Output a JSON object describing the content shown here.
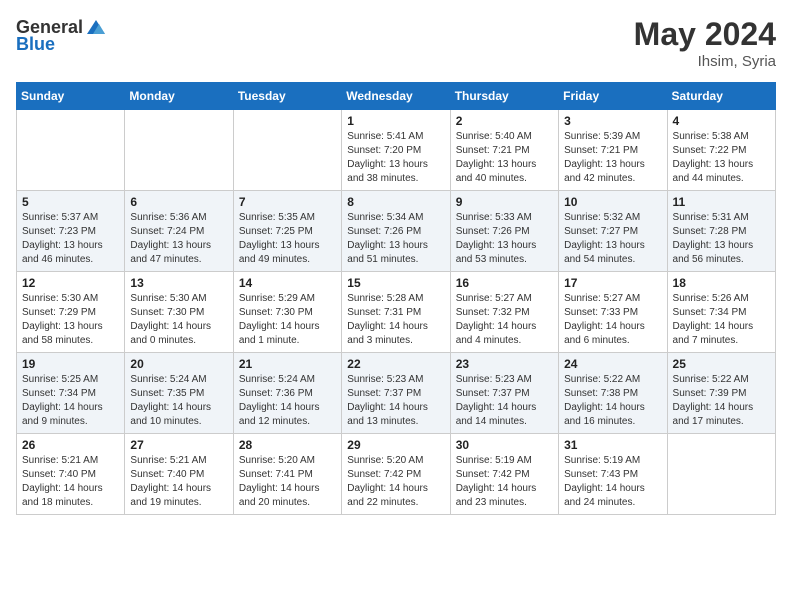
{
  "header": {
    "logo_general": "General",
    "logo_blue": "Blue",
    "month_year": "May 2024",
    "location": "Ihsim, Syria"
  },
  "days_of_week": [
    "Sunday",
    "Monday",
    "Tuesday",
    "Wednesday",
    "Thursday",
    "Friday",
    "Saturday"
  ],
  "weeks": [
    [
      {
        "day": "",
        "sunrise": "",
        "sunset": "",
        "daylight": ""
      },
      {
        "day": "",
        "sunrise": "",
        "sunset": "",
        "daylight": ""
      },
      {
        "day": "",
        "sunrise": "",
        "sunset": "",
        "daylight": ""
      },
      {
        "day": "1",
        "sunrise": "Sunrise: 5:41 AM",
        "sunset": "Sunset: 7:20 PM",
        "daylight": "Daylight: 13 hours and 38 minutes."
      },
      {
        "day": "2",
        "sunrise": "Sunrise: 5:40 AM",
        "sunset": "Sunset: 7:21 PM",
        "daylight": "Daylight: 13 hours and 40 minutes."
      },
      {
        "day": "3",
        "sunrise": "Sunrise: 5:39 AM",
        "sunset": "Sunset: 7:21 PM",
        "daylight": "Daylight: 13 hours and 42 minutes."
      },
      {
        "day": "4",
        "sunrise": "Sunrise: 5:38 AM",
        "sunset": "Sunset: 7:22 PM",
        "daylight": "Daylight: 13 hours and 44 minutes."
      }
    ],
    [
      {
        "day": "5",
        "sunrise": "Sunrise: 5:37 AM",
        "sunset": "Sunset: 7:23 PM",
        "daylight": "Daylight: 13 hours and 46 minutes."
      },
      {
        "day": "6",
        "sunrise": "Sunrise: 5:36 AM",
        "sunset": "Sunset: 7:24 PM",
        "daylight": "Daylight: 13 hours and 47 minutes."
      },
      {
        "day": "7",
        "sunrise": "Sunrise: 5:35 AM",
        "sunset": "Sunset: 7:25 PM",
        "daylight": "Daylight: 13 hours and 49 minutes."
      },
      {
        "day": "8",
        "sunrise": "Sunrise: 5:34 AM",
        "sunset": "Sunset: 7:26 PM",
        "daylight": "Daylight: 13 hours and 51 minutes."
      },
      {
        "day": "9",
        "sunrise": "Sunrise: 5:33 AM",
        "sunset": "Sunset: 7:26 PM",
        "daylight": "Daylight: 13 hours and 53 minutes."
      },
      {
        "day": "10",
        "sunrise": "Sunrise: 5:32 AM",
        "sunset": "Sunset: 7:27 PM",
        "daylight": "Daylight: 13 hours and 54 minutes."
      },
      {
        "day": "11",
        "sunrise": "Sunrise: 5:31 AM",
        "sunset": "Sunset: 7:28 PM",
        "daylight": "Daylight: 13 hours and 56 minutes."
      }
    ],
    [
      {
        "day": "12",
        "sunrise": "Sunrise: 5:30 AM",
        "sunset": "Sunset: 7:29 PM",
        "daylight": "Daylight: 13 hours and 58 minutes."
      },
      {
        "day": "13",
        "sunrise": "Sunrise: 5:30 AM",
        "sunset": "Sunset: 7:30 PM",
        "daylight": "Daylight: 14 hours and 0 minutes."
      },
      {
        "day": "14",
        "sunrise": "Sunrise: 5:29 AM",
        "sunset": "Sunset: 7:30 PM",
        "daylight": "Daylight: 14 hours and 1 minute."
      },
      {
        "day": "15",
        "sunrise": "Sunrise: 5:28 AM",
        "sunset": "Sunset: 7:31 PM",
        "daylight": "Daylight: 14 hours and 3 minutes."
      },
      {
        "day": "16",
        "sunrise": "Sunrise: 5:27 AM",
        "sunset": "Sunset: 7:32 PM",
        "daylight": "Daylight: 14 hours and 4 minutes."
      },
      {
        "day": "17",
        "sunrise": "Sunrise: 5:27 AM",
        "sunset": "Sunset: 7:33 PM",
        "daylight": "Daylight: 14 hours and 6 minutes."
      },
      {
        "day": "18",
        "sunrise": "Sunrise: 5:26 AM",
        "sunset": "Sunset: 7:34 PM",
        "daylight": "Daylight: 14 hours and 7 minutes."
      }
    ],
    [
      {
        "day": "19",
        "sunrise": "Sunrise: 5:25 AM",
        "sunset": "Sunset: 7:34 PM",
        "daylight": "Daylight: 14 hours and 9 minutes."
      },
      {
        "day": "20",
        "sunrise": "Sunrise: 5:24 AM",
        "sunset": "Sunset: 7:35 PM",
        "daylight": "Daylight: 14 hours and 10 minutes."
      },
      {
        "day": "21",
        "sunrise": "Sunrise: 5:24 AM",
        "sunset": "Sunset: 7:36 PM",
        "daylight": "Daylight: 14 hours and 12 minutes."
      },
      {
        "day": "22",
        "sunrise": "Sunrise: 5:23 AM",
        "sunset": "Sunset: 7:37 PM",
        "daylight": "Daylight: 14 hours and 13 minutes."
      },
      {
        "day": "23",
        "sunrise": "Sunrise: 5:23 AM",
        "sunset": "Sunset: 7:37 PM",
        "daylight": "Daylight: 14 hours and 14 minutes."
      },
      {
        "day": "24",
        "sunrise": "Sunrise: 5:22 AM",
        "sunset": "Sunset: 7:38 PM",
        "daylight": "Daylight: 14 hours and 16 minutes."
      },
      {
        "day": "25",
        "sunrise": "Sunrise: 5:22 AM",
        "sunset": "Sunset: 7:39 PM",
        "daylight": "Daylight: 14 hours and 17 minutes."
      }
    ],
    [
      {
        "day": "26",
        "sunrise": "Sunrise: 5:21 AM",
        "sunset": "Sunset: 7:40 PM",
        "daylight": "Daylight: 14 hours and 18 minutes."
      },
      {
        "day": "27",
        "sunrise": "Sunrise: 5:21 AM",
        "sunset": "Sunset: 7:40 PM",
        "daylight": "Daylight: 14 hours and 19 minutes."
      },
      {
        "day": "28",
        "sunrise": "Sunrise: 5:20 AM",
        "sunset": "Sunset: 7:41 PM",
        "daylight": "Daylight: 14 hours and 20 minutes."
      },
      {
        "day": "29",
        "sunrise": "Sunrise: 5:20 AM",
        "sunset": "Sunset: 7:42 PM",
        "daylight": "Daylight: 14 hours and 22 minutes."
      },
      {
        "day": "30",
        "sunrise": "Sunrise: 5:19 AM",
        "sunset": "Sunset: 7:42 PM",
        "daylight": "Daylight: 14 hours and 23 minutes."
      },
      {
        "day": "31",
        "sunrise": "Sunrise: 5:19 AM",
        "sunset": "Sunset: 7:43 PM",
        "daylight": "Daylight: 14 hours and 24 minutes."
      },
      {
        "day": "",
        "sunrise": "",
        "sunset": "",
        "daylight": ""
      }
    ]
  ]
}
